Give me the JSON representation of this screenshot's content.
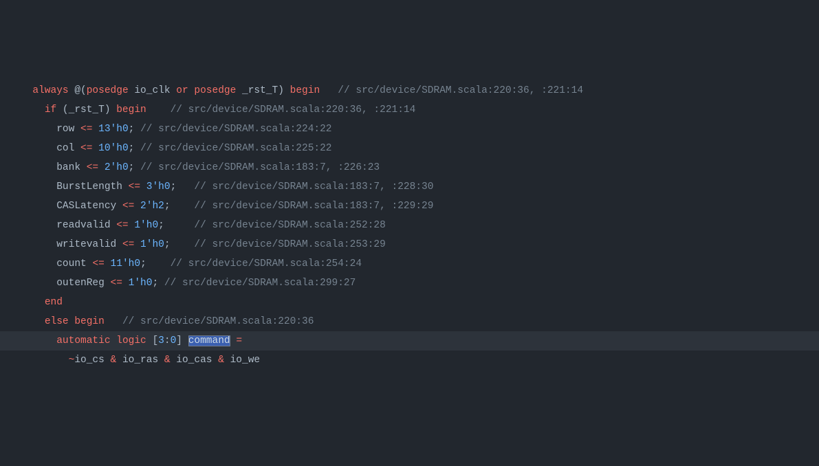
{
  "code": {
    "lines": [
      {
        "indent": 1,
        "segments": [
          {
            "t": "always",
            "c": "kw"
          },
          {
            "t": " @("
          },
          {
            "t": "posedge",
            "c": "kw"
          },
          {
            "t": " io_clk "
          },
          {
            "t": "or",
            "c": "kw"
          },
          {
            "t": " "
          },
          {
            "t": "posedge",
            "c": "kw"
          },
          {
            "t": " _rst_T) "
          },
          {
            "t": "begin",
            "c": "kw"
          },
          {
            "t": "   "
          },
          {
            "t": "// src/device/SDRAM.scala:220:36, :221:14",
            "c": "cmt"
          }
        ]
      },
      {
        "indent": 2,
        "segments": [
          {
            "t": "if",
            "c": "kw"
          },
          {
            "t": " (_rst_T) "
          },
          {
            "t": "begin",
            "c": "kw"
          },
          {
            "t": "    "
          },
          {
            "t": "// src/device/SDRAM.scala:220:36, :221:14",
            "c": "cmt"
          }
        ]
      },
      {
        "indent": 3,
        "segments": [
          {
            "t": "row "
          },
          {
            "t": "<=",
            "c": "kw"
          },
          {
            "t": " "
          },
          {
            "t": "13'h0",
            "c": "num"
          },
          {
            "t": "; "
          },
          {
            "t": "// src/device/SDRAM.scala:224:22",
            "c": "cmt"
          }
        ]
      },
      {
        "indent": 3,
        "segments": [
          {
            "t": "col "
          },
          {
            "t": "<=",
            "c": "kw"
          },
          {
            "t": " "
          },
          {
            "t": "10'h0",
            "c": "num"
          },
          {
            "t": "; "
          },
          {
            "t": "// src/device/SDRAM.scala:225:22",
            "c": "cmt"
          }
        ]
      },
      {
        "indent": 3,
        "segments": [
          {
            "t": "bank "
          },
          {
            "t": "<=",
            "c": "kw"
          },
          {
            "t": " "
          },
          {
            "t": "2'h0",
            "c": "num"
          },
          {
            "t": "; "
          },
          {
            "t": "// src/device/SDRAM.scala:183:7, :226:23",
            "c": "cmt"
          }
        ]
      },
      {
        "indent": 3,
        "segments": [
          {
            "t": "BurstLength "
          },
          {
            "t": "<=",
            "c": "kw"
          },
          {
            "t": " "
          },
          {
            "t": "3'h0",
            "c": "num"
          },
          {
            "t": ";   "
          },
          {
            "t": "// src/device/SDRAM.scala:183:7, :228:30",
            "c": "cmt"
          }
        ]
      },
      {
        "indent": 3,
        "segments": [
          {
            "t": "CASLatency "
          },
          {
            "t": "<=",
            "c": "kw"
          },
          {
            "t": " "
          },
          {
            "t": "2'h2",
            "c": "num"
          },
          {
            "t": ";    "
          },
          {
            "t": "// src/device/SDRAM.scala:183:7, :229:29",
            "c": "cmt"
          }
        ]
      },
      {
        "indent": 3,
        "segments": [
          {
            "t": "readvalid "
          },
          {
            "t": "<=",
            "c": "kw"
          },
          {
            "t": " "
          },
          {
            "t": "1'h0",
            "c": "num"
          },
          {
            "t": ";     "
          },
          {
            "t": "// src/device/SDRAM.scala:252:28",
            "c": "cmt"
          }
        ]
      },
      {
        "indent": 3,
        "segments": [
          {
            "t": "writevalid "
          },
          {
            "t": "<=",
            "c": "kw"
          },
          {
            "t": " "
          },
          {
            "t": "1'h0",
            "c": "num"
          },
          {
            "t": ";    "
          },
          {
            "t": "// src/device/SDRAM.scala:253:29",
            "c": "cmt"
          }
        ]
      },
      {
        "indent": 3,
        "segments": [
          {
            "t": "count "
          },
          {
            "t": "<=",
            "c": "kw"
          },
          {
            "t": " "
          },
          {
            "t": "11'h0",
            "c": "num"
          },
          {
            "t": ";    "
          },
          {
            "t": "// src/device/SDRAM.scala:254:24",
            "c": "cmt"
          }
        ]
      },
      {
        "indent": 3,
        "segments": [
          {
            "t": "outenReg "
          },
          {
            "t": "<=",
            "c": "kw"
          },
          {
            "t": " "
          },
          {
            "t": "1'h0",
            "c": "num"
          },
          {
            "t": "; "
          },
          {
            "t": "// src/device/SDRAM.scala:299:27",
            "c": "cmt"
          }
        ]
      },
      {
        "indent": 2,
        "segments": [
          {
            "t": "end",
            "c": "kw"
          }
        ]
      },
      {
        "indent": 2,
        "segments": [
          {
            "t": "else",
            "c": "kw"
          },
          {
            "t": " "
          },
          {
            "t": "begin",
            "c": "kw"
          },
          {
            "t": "   "
          },
          {
            "t": "// src/device/SDRAM.scala:220:36",
            "c": "cmt"
          }
        ]
      },
      {
        "indent": 3,
        "hl": true,
        "segments": [
          {
            "t": "automatic",
            "c": "kw"
          },
          {
            "t": " "
          },
          {
            "t": "logic",
            "c": "kw"
          },
          {
            "t": " ["
          },
          {
            "t": "3",
            "c": "num"
          },
          {
            "t": ":"
          },
          {
            "t": "0",
            "c": "num"
          },
          {
            "t": "] "
          },
          {
            "t": "command",
            "c": "sel"
          },
          {
            "t": " "
          },
          {
            "t": "=",
            "c": "kw"
          }
        ]
      },
      {
        "indent": 4,
        "segments": [
          {
            "t": "~",
            "c": "kw"
          },
          {
            "t": "io_cs "
          },
          {
            "t": "&",
            "c": "kw"
          },
          {
            "t": " io_ras "
          },
          {
            "t": "&",
            "c": "kw"
          },
          {
            "t": " io_cas "
          },
          {
            "t": "&",
            "c": "kw"
          },
          {
            "t": " io_we"
          }
        ]
      }
    ]
  }
}
